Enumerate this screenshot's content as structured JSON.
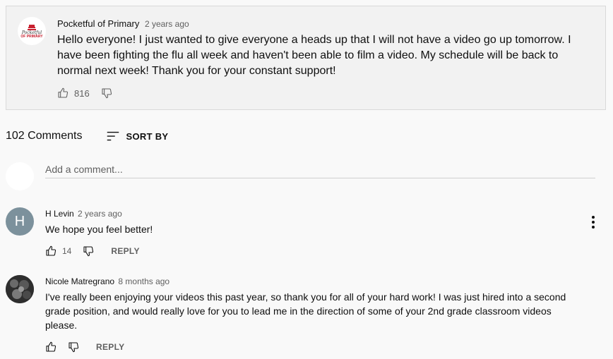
{
  "post": {
    "author": "Pocketful of Primary",
    "time": "2 years ago",
    "text": "Hello everyone! I just wanted to give everyone a heads up that I will not have a video go up tomorrow. I have been fighting the flu all week and haven't been able to film a video. My schedule will be back to normal next week! Thank you for your constant support!",
    "likes": "816",
    "avatar_logo_line1": "Pocketful",
    "avatar_logo_line2": "OF PRIMARY"
  },
  "comments_header": {
    "count": "102 Comments",
    "sort_label": "SORT BY"
  },
  "add_comment": {
    "placeholder": "Add a comment..."
  },
  "comments": [
    {
      "author": "H Levin",
      "time": "2 years ago",
      "text": "We hope you feel better!",
      "likes": "14",
      "reply_label": "REPLY",
      "avatar_letter": "H"
    },
    {
      "author": "Nicole Matregrano",
      "time": "8 months ago",
      "text": "I've really been enjoying your videos this past year, so thank you for all of your hard work! I was just hired into a second grade position, and would really love for you to lead me in the direction of some of your 2nd grade classroom videos please.",
      "likes": "",
      "reply_label": "REPLY"
    }
  ],
  "colors": {
    "h_avatar_bg": "#7c919c",
    "logo_red": "#c8202f"
  }
}
